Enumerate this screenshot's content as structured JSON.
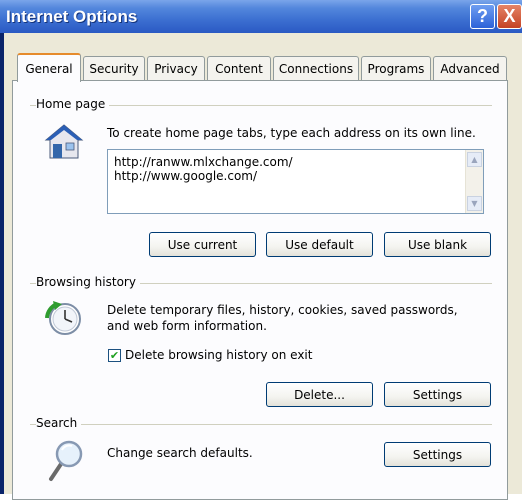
{
  "window": {
    "title": "Internet Options",
    "help_label": "?",
    "close_label": "X"
  },
  "tabs": [
    {
      "label": "General",
      "active": true
    },
    {
      "label": "Security"
    },
    {
      "label": "Privacy"
    },
    {
      "label": "Content"
    },
    {
      "label": "Connections"
    },
    {
      "label": "Programs"
    },
    {
      "label": "Advanced"
    }
  ],
  "home_page": {
    "group_label": "Home page",
    "description": "To create home page tabs, type each address on its own line.",
    "addresses": [
      "http://ranww.mlxchange.com/",
      "http://www.google.com/"
    ],
    "buttons": {
      "use_current": "Use current",
      "use_default": "Use default",
      "use_blank": "Use blank"
    }
  },
  "browsing_history": {
    "group_label": "Browsing history",
    "description_line1": "Delete temporary files, history, cookies, saved passwords,",
    "description_line2": "and web form information.",
    "delete_on_exit_label": "Delete browsing history on exit",
    "delete_on_exit_checked": true,
    "delete_button": "Delete...",
    "settings_button": "Settings"
  },
  "search": {
    "group_label": "Search",
    "description": "Change search defaults.",
    "settings_button": "Settings"
  },
  "colors": {
    "title_bar": "#3c6fd1",
    "dialog_bg": "#ece9d8",
    "tab_accent": "#e68b2c",
    "check_mark": "#21a121"
  },
  "icons": [
    "help-icon",
    "close-icon",
    "home-icon",
    "history-icon",
    "search-icon",
    "checkmark-icon"
  ]
}
